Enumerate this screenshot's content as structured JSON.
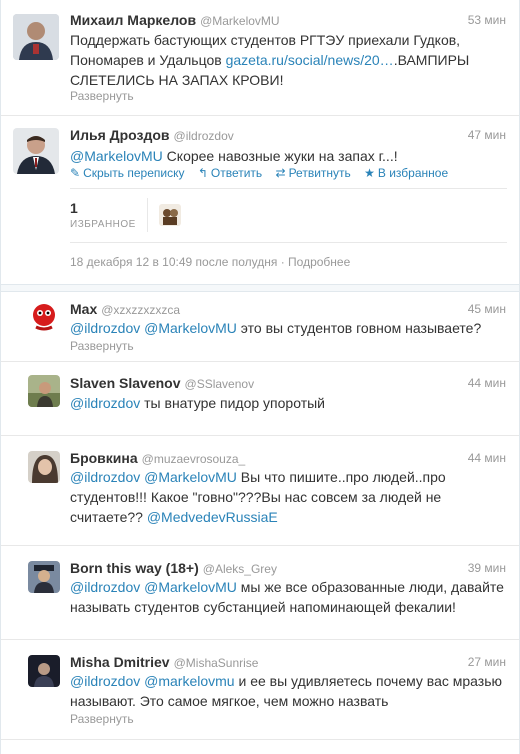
{
  "tweets": [
    {
      "name": "Михаил Маркелов",
      "handle": "@MarkelovMU",
      "time": "53 мин",
      "lines": [
        "Поддержать бастующих студентов РГТЭУ приехали Гудков,",
        "Пономарев и Удальцов ",
        "gazeta.ru/social/news/20…",
        ".ВАМПИРЫ",
        "СЛЕТЕЛИСЬ НА ЗАПАХ КРОВИ!"
      ],
      "expand": "Развернуть"
    },
    {
      "name": "Илья Дроздов",
      "handle": "@ildrozdov",
      "time": "47 мин",
      "mention": "@MarkelovMU",
      "text": " Скорее навозные жуки на запах г...!",
      "actions": [
        "Скрыть переписку",
        "Ответить",
        "Ретвитнуть",
        "В избранное"
      ],
      "fav_count": "1",
      "fav_label": "ИЗБРАННОЕ",
      "date": "18 декабря 12 в 10:49 после полудня · Подробнее"
    }
  ],
  "replies": [
    {
      "name": "Max",
      "handle": "@xzxzzxzxzca",
      "time": "45 мин",
      "line1": [
        "@ildrozdov",
        " ",
        "@MarkelovMU",
        " это вы студентов говном называете?"
      ],
      "expand": "Развернуть"
    },
    {
      "name": "Slaven Slavenov",
      "handle": "@SSlavenov",
      "time": "44 мин",
      "line1": [
        "@ildrozdov",
        " ты внатуре пидор упоротый"
      ]
    },
    {
      "name": "Бровкина",
      "handle": "@muzaevrosouza_",
      "time": "44 мин",
      "line1": [
        "@ildrozdov",
        " ",
        "@MarkelovMU",
        " Вы что пишите..про людей..про"
      ],
      "line2": "студентов!!! Какое \"говно\"???Вы нас совсем за людей не",
      "line3": [
        "считаете?? ",
        "@MedvedevRussiaE"
      ]
    },
    {
      "name": "Born this way (18+)",
      "handle": "@Aleks_Grey",
      "time": "39 мин",
      "line1": [
        "@ildrozdov",
        " ",
        "@MarkelovMU",
        " мы же все образованные люди, давайте"
      ],
      "line2": "называть студентов субстанцией напоминающей фекалии!"
    },
    {
      "name": "Misha Dmitriev",
      "handle": "@MishaSunrise",
      "time": "27 мин",
      "line1": [
        "@ildrozdov",
        " ",
        "@markelovmu",
        " и ее вы удивляетесь почему вас мразью"
      ],
      "line2": "называют. Это самое мягкое, чем можно назвать",
      "expand": "Развернуть"
    }
  ],
  "colors": {
    "link": "#2a83b8",
    "muted": "#999999"
  },
  "icons": [
    "reply-icon",
    "retweet-icon",
    "favorite-icon",
    "conversation-icon"
  ]
}
